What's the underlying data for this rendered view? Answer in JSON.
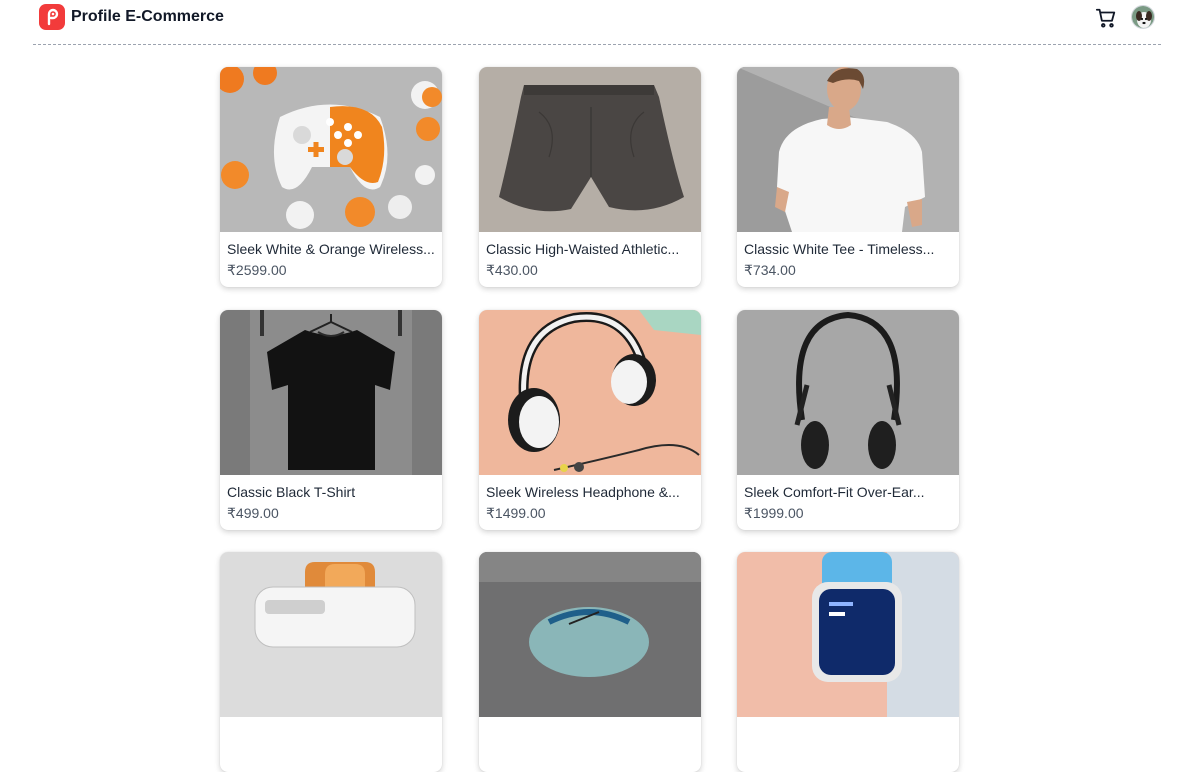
{
  "header": {
    "brand": "Profile E-Commerce",
    "logo_icon": "profile-p-logo-icon",
    "cart_icon": "shopping-cart-icon",
    "avatar_icon": "user-avatar-icon",
    "accent_color": "#f23b3b"
  },
  "products": [
    {
      "title": "Sleek White & Orange Wireless...",
      "price": "₹2599.00",
      "image_icon": "game-controller-image"
    },
    {
      "title": "Classic High-Waisted Athletic...",
      "price": "₹430.00",
      "image_icon": "shorts-image"
    },
    {
      "title": "Classic White Tee - Timeless...",
      "price": "₹734.00",
      "image_icon": "white-tee-model-image"
    },
    {
      "title": "Classic Black T-Shirt",
      "price": "₹499.00",
      "image_icon": "black-tshirt-image"
    },
    {
      "title": "Sleek Wireless Headphone &...",
      "price": "₹1499.00",
      "image_icon": "headphones-earbuds-image"
    },
    {
      "title": "Sleek Comfort-Fit Over-Ear...",
      "price": "₹1999.00",
      "image_icon": "black-headphones-image"
    },
    {
      "title": "",
      "price": "",
      "image_icon": "toaster-image"
    },
    {
      "title": "",
      "price": "",
      "image_icon": "mouse-image"
    },
    {
      "title": "",
      "price": "",
      "image_icon": "smartwatch-image"
    }
  ]
}
